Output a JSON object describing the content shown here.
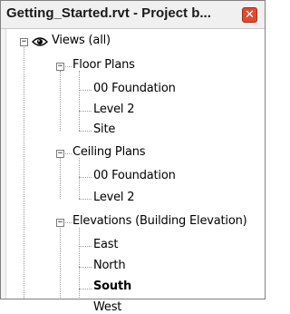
{
  "window": {
    "title": "Getting_Started.rvt - Project b...",
    "close_glyph": "✕"
  },
  "tree": {
    "root": {
      "label": "Views (all)",
      "icon": "eye-icon"
    },
    "floor_plans": {
      "label": "Floor Plans",
      "items": [
        "00 Foundation",
        "Level 2",
        "Site"
      ]
    },
    "ceiling_plans": {
      "label": "Ceiling Plans",
      "items": [
        "00 Foundation",
        "Level 2"
      ]
    },
    "elevations": {
      "label": "Elevations (Building Elevation)",
      "items": [
        "East",
        "North",
        "South",
        "West"
      ],
      "active_item": "South"
    }
  }
}
